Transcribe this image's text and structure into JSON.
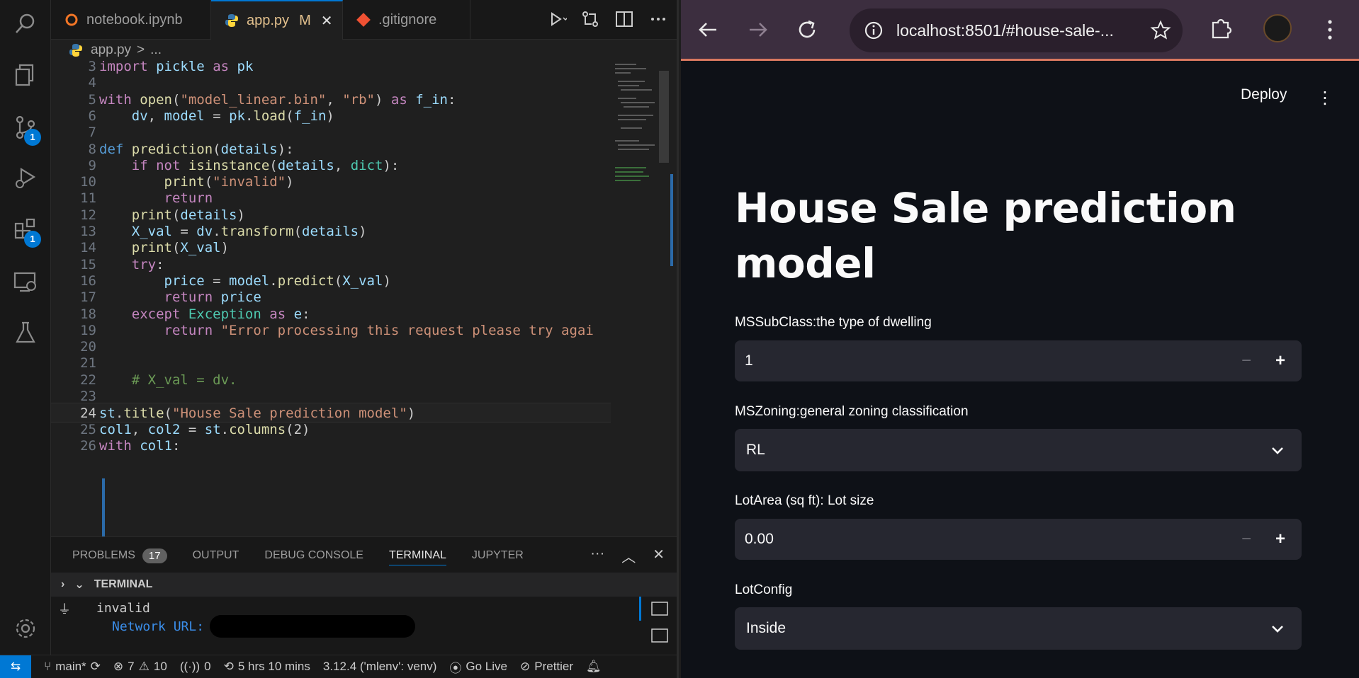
{
  "vscode": {
    "tabs": [
      {
        "label": "notebook.ipynb",
        "icon": "jupyter-icon"
      },
      {
        "label": "app.py",
        "modified": "M",
        "icon": "python-icon"
      },
      {
        "label": ".gitignore",
        "icon": "git-icon"
      }
    ],
    "activity_badges": {
      "source_control": "1",
      "extensions": "1"
    },
    "breadcrumb": {
      "file": "app.py",
      "sep": ">",
      "more": "..."
    },
    "code_lines": [
      {
        "n": "3",
        "text": "import pickle as pk"
      },
      {
        "n": "4",
        "text": ""
      },
      {
        "n": "5",
        "text": "with open(\"model_linear.bin\", \"rb\") as f_in:"
      },
      {
        "n": "6",
        "text": "    dv, model = pk.load(f_in)"
      },
      {
        "n": "7",
        "text": ""
      },
      {
        "n": "8",
        "text": "def prediction(details):"
      },
      {
        "n": "9",
        "text": "    if not isinstance(details, dict):"
      },
      {
        "n": "10",
        "text": "        print(\"invalid\")"
      },
      {
        "n": "11",
        "text": "        return"
      },
      {
        "n": "12",
        "text": "    print(details)"
      },
      {
        "n": "13",
        "text": "    X_val = dv.transform(details)"
      },
      {
        "n": "14",
        "text": "    print(X_val)"
      },
      {
        "n": "15",
        "text": "    try:"
      },
      {
        "n": "16",
        "text": "        price = model.predict(X_val)"
      },
      {
        "n": "17",
        "text": "        return price"
      },
      {
        "n": "18",
        "text": "    except Exception as e:"
      },
      {
        "n": "19",
        "text": "        return \"Error processing this request please try agai"
      },
      {
        "n": "20",
        "text": ""
      },
      {
        "n": "21",
        "text": ""
      },
      {
        "n": "22",
        "text": "    # X_val = dv."
      },
      {
        "n": "23",
        "text": ""
      },
      {
        "n": "24",
        "text": "st.title(\"House Sale prediction model\")"
      },
      {
        "n": "25",
        "text": "col1, col2 = st.columns(2)"
      },
      {
        "n": "26",
        "text": "with col1:"
      }
    ],
    "panel": {
      "tabs": [
        "PROBLEMS",
        "OUTPUT",
        "DEBUG CONSOLE",
        "TERMINAL",
        "JUPYTER"
      ],
      "problems_count": "17",
      "terminal_header": "TERMINAL",
      "terminal_lines": [
        "invalid",
        "Network URL:"
      ]
    },
    "status": {
      "branch": "main*",
      "errors": "7",
      "warnings": "10",
      "ports": "0",
      "time": "5 hrs 10 mins",
      "interpreter": "3.12.4 ('mlenv': venv)",
      "golive": "Go Live",
      "prettier": "Prettier"
    }
  },
  "browser": {
    "url": "localhost:8501/#house-sale-...",
    "deploy_label": "Deploy",
    "title": "House Sale prediction model",
    "fields": [
      {
        "label": "MSSubClass:the type of dwelling",
        "kind": "number",
        "value": "1"
      },
      {
        "label": "MSZoning:general zoning classification",
        "kind": "select",
        "value": "RL"
      },
      {
        "label": "LotArea (sq ft): Lot size",
        "kind": "number",
        "value": "0.00"
      },
      {
        "label": "LotConfig",
        "kind": "select",
        "value": "Inside"
      }
    ]
  }
}
